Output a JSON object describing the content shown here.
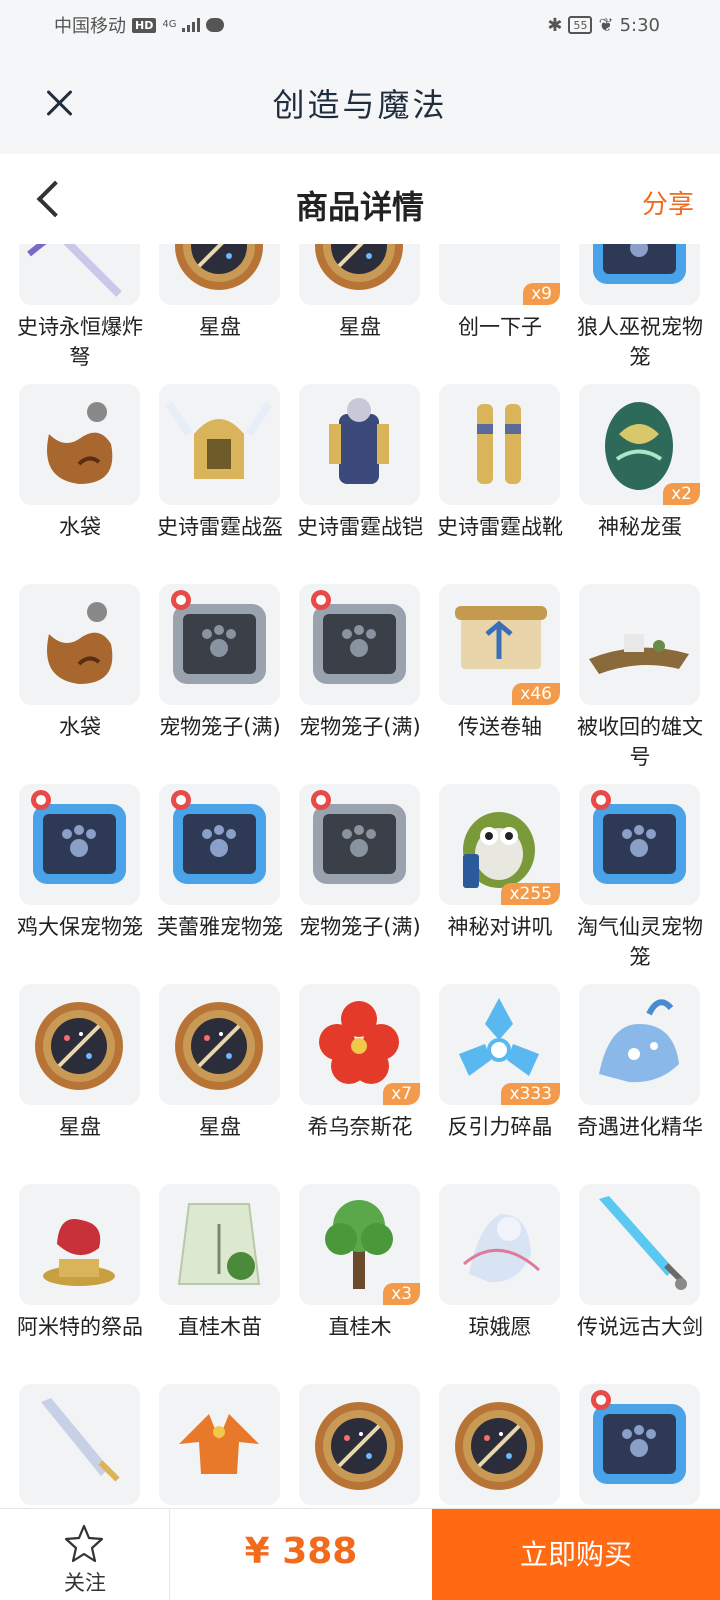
{
  "status": {
    "carrier": "中国移动",
    "hd": "HD",
    "network": "4G",
    "battery": "55",
    "time": "5:30"
  },
  "app": {
    "title": "创造与魔法"
  },
  "page": {
    "title": "商品详情",
    "share": "分享"
  },
  "items": [
    {
      "name": "史诗永恒爆炸弩",
      "icon": "crossbow-icon",
      "qty": ""
    },
    {
      "name": "星盘",
      "icon": "astrolabe-icon",
      "qty": ""
    },
    {
      "name": "星盘",
      "icon": "astrolabe-icon",
      "qty": ""
    },
    {
      "name": "创一下子",
      "icon": "sticker-icon",
      "qty": "x9"
    },
    {
      "name": "狼人巫祝宠物笼",
      "icon": "pet-cage-blue-icon",
      "qty": ""
    },
    {
      "name": "水袋",
      "icon": "water-bag-icon",
      "qty": ""
    },
    {
      "name": "史诗雷霆战盔",
      "icon": "helmet-icon",
      "qty": ""
    },
    {
      "name": "史诗雷霆战铠",
      "icon": "armor-icon",
      "qty": ""
    },
    {
      "name": "史诗雷霆战靴",
      "icon": "boots-icon",
      "qty": ""
    },
    {
      "name": "神秘龙蛋",
      "icon": "dragon-egg-icon",
      "qty": "x2"
    },
    {
      "name": "水袋",
      "icon": "water-bag-icon",
      "qty": ""
    },
    {
      "name": "宠物笼子(满)",
      "icon": "pet-cage-grey-icon",
      "qty": ""
    },
    {
      "name": "宠物笼子(满)",
      "icon": "pet-cage-grey-icon",
      "qty": ""
    },
    {
      "name": "传送卷轴",
      "icon": "scroll-icon",
      "qty": "x46"
    },
    {
      "name": "被收回的雄文号",
      "icon": "wreck-icon",
      "qty": ""
    },
    {
      "name": "鸡大保宠物笼",
      "icon": "pet-cage-blue-icon",
      "qty": ""
    },
    {
      "name": "芙蕾雅宠物笼",
      "icon": "pet-cage-blue-icon",
      "qty": ""
    },
    {
      "name": "宠物笼子(满)",
      "icon": "pet-cage-grey-icon",
      "qty": ""
    },
    {
      "name": "神秘对讲叽",
      "icon": "walkie-bird-icon",
      "qty": "x255"
    },
    {
      "name": "淘气仙灵宠物笼",
      "icon": "pet-cage-blue-icon",
      "qty": ""
    },
    {
      "name": "星盘",
      "icon": "astrolabe-icon",
      "qty": ""
    },
    {
      "name": "星盘",
      "icon": "astrolabe-icon",
      "qty": ""
    },
    {
      "name": "希乌奈斯花",
      "icon": "flower-icon",
      "qty": "x7"
    },
    {
      "name": "反引力碎晶",
      "icon": "crystal-icon",
      "qty": "x333"
    },
    {
      "name": "奇遇进化精华",
      "icon": "essence-icon",
      "qty": ""
    },
    {
      "name": "阿米特的祭品",
      "icon": "offering-icon",
      "qty": ""
    },
    {
      "name": "直桂木苗",
      "icon": "seed-bag-icon",
      "qty": ""
    },
    {
      "name": "直桂木",
      "icon": "tree-icon",
      "qty": "x3"
    },
    {
      "name": "琼娥愿",
      "icon": "spirit-icon",
      "qty": ""
    },
    {
      "name": "传说远古大剑",
      "icon": "sword-icon",
      "qty": ""
    },
    {
      "name": "",
      "icon": "sword-gold-icon",
      "qty": ""
    },
    {
      "name": "",
      "icon": "dragon-icon",
      "qty": ""
    },
    {
      "name": "",
      "icon": "astrolabe-icon",
      "qty": ""
    },
    {
      "name": "",
      "icon": "astrolabe-icon",
      "qty": ""
    },
    {
      "name": "",
      "icon": "pet-cage-blue-icon",
      "qty": ""
    }
  ],
  "bottom": {
    "follow": "关注",
    "price": "¥ 388",
    "buy": "立即购买"
  }
}
